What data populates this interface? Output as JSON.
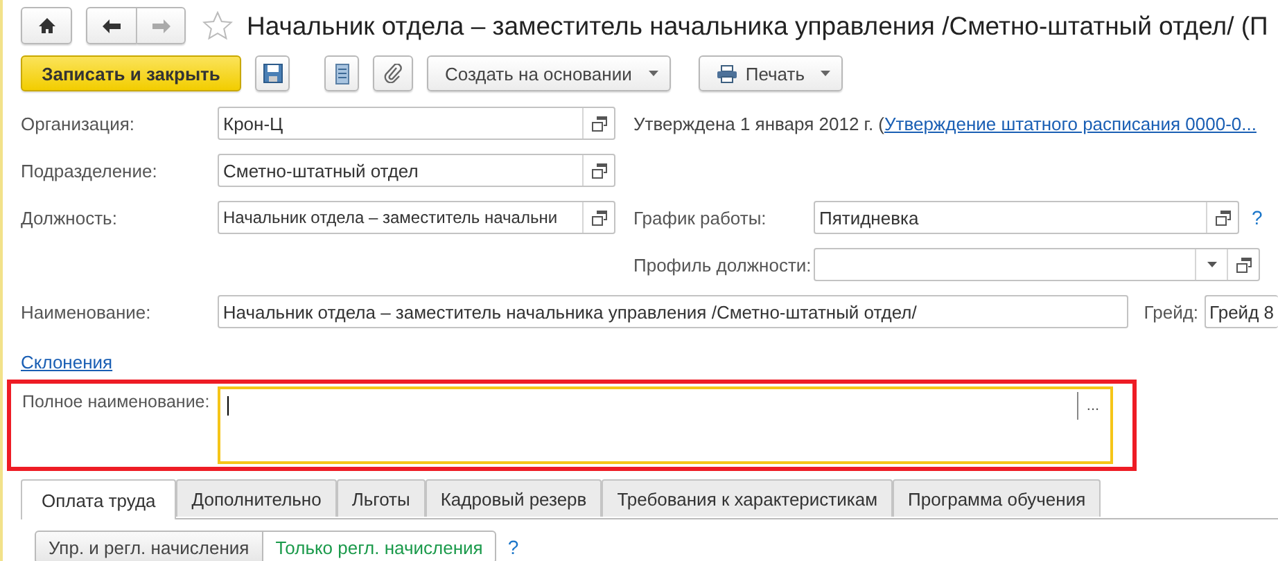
{
  "header": {
    "title": "Начальник отдела – заместитель начальника управления /Сметно-штатный отдел/ (П",
    "favorite": false
  },
  "toolbar": {
    "save_close": "Записать и закрыть",
    "create_based_on": "Создать на основании",
    "print": "Печать"
  },
  "organization": {
    "label": "Организация:",
    "value": "Крон-Ц"
  },
  "approval": {
    "text": "Утверждена 1 января 2012 г. (",
    "link": "Утверждение штатного расписания 0000-0..."
  },
  "department": {
    "label": "Подразделение:",
    "value": "Сметно-штатный отдел"
  },
  "position": {
    "label": "Должность:",
    "value": "Начальник отдела – заместитель начальни"
  },
  "schedule": {
    "label": "График работы:",
    "value": "Пятидневка",
    "help": "?"
  },
  "profile": {
    "label": "Профиль должности:"
  },
  "name": {
    "label": "Наименование:",
    "value": "Начальник отдела – заместитель начальника управления /Сметно-штатный отдел/"
  },
  "grade": {
    "label": "Грейд:",
    "value": "Грейд 8"
  },
  "declensions_link": "Склонения",
  "full_name": {
    "label": "Полное наименование:",
    "focused": true,
    "highlighted": true,
    "button": "..."
  },
  "tabs": [
    {
      "label": "Оплата труда",
      "selected": true
    },
    {
      "label": "Дополнительно",
      "selected": false
    },
    {
      "label": "Льготы",
      "selected": false
    },
    {
      "label": "Кадровый резерв",
      "selected": false
    },
    {
      "label": "Требования к характеристикам",
      "selected": false
    },
    {
      "label": "Программа обучения",
      "selected": false
    }
  ],
  "accrual_modes": [
    {
      "label": "Упр. и регл. начисления",
      "selected": false
    },
    {
      "label": "Только регл. начисления",
      "selected": true
    }
  ],
  "accrual_help": "?"
}
